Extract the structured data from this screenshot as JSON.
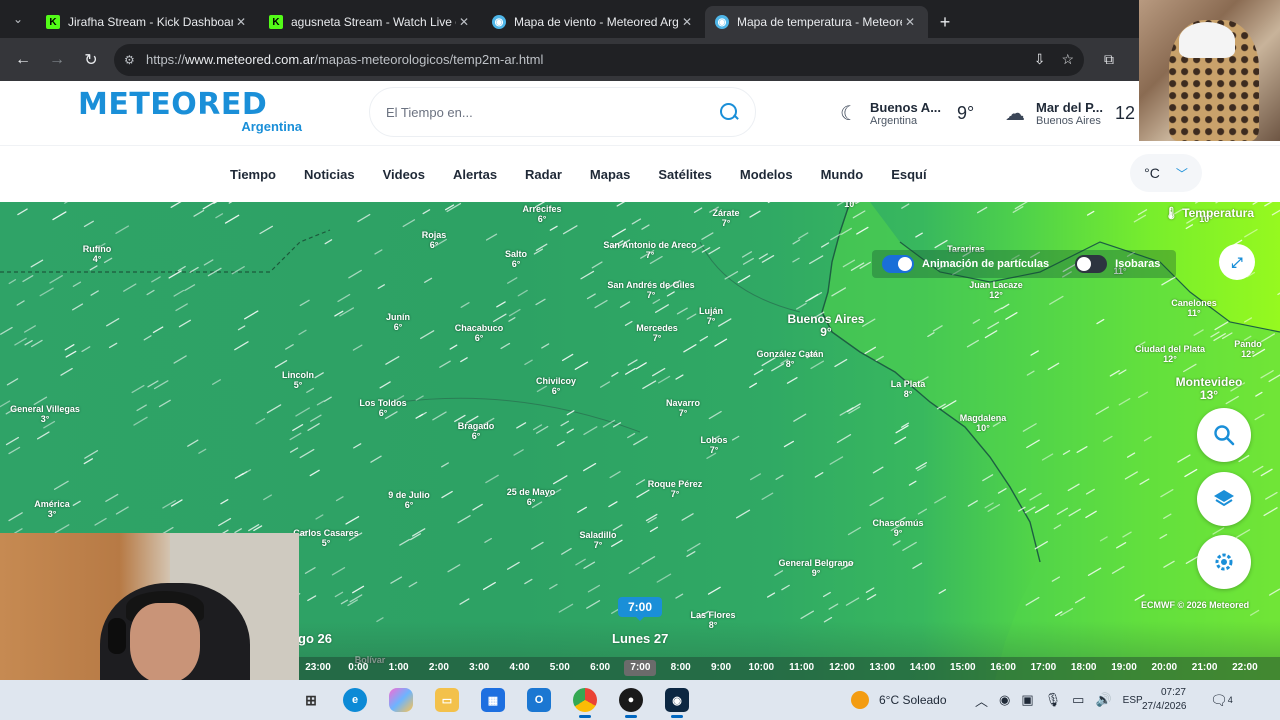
{
  "browser": {
    "tabs": [
      {
        "title": "Jirafha Stream - Kick Dashboard",
        "favicon": "kick-icon",
        "active": false
      },
      {
        "title": "agusneta Stream - Watch Live on Kick",
        "favicon": "kick-icon",
        "active": false
      },
      {
        "title": "Mapa de viento - Meteored Argentina",
        "favicon": "meteored-icon",
        "active": false
      },
      {
        "title": "Mapa de temperatura - Meteored Argentina",
        "favicon": "meteored-icon",
        "active": true
      }
    ],
    "url_host": "www.meteored.com.ar",
    "url_prefix": "https://",
    "url_path": "/mapas-meteorologicos/temp2m-ar.html"
  },
  "site": {
    "logo_text": "METEORED",
    "logo_sub": "Argentina",
    "search_placeholder": "El Tiempo en...",
    "weather_widgets": [
      {
        "city": "Buenos A...",
        "region": "Argentina",
        "temp": "9°",
        "icon": "moon-icon"
      },
      {
        "city": "Mar del P...",
        "region": "Buenos Aires",
        "temp": "12",
        "icon": "cloud-rain-icon"
      }
    ],
    "nav": [
      "Tiempo",
      "Noticias",
      "Videos",
      "Alertas",
      "Radar",
      "Mapas",
      "Satélites",
      "Modelos",
      "Mundo",
      "Esquí"
    ],
    "unit": "°C"
  },
  "map": {
    "layer_title": "Temperatura",
    "toggle_particles": "Animación de partículas",
    "toggle_isobars": "Isobaras",
    "credit": "ECMWF © 2026 Meteored",
    "selected_time": "7:00",
    "day_prev": "go 26",
    "day_current": "Lunes 27",
    "hours": [
      "23:00",
      "0:00",
      "1:00",
      "2:00",
      "3:00",
      "4:00",
      "5:00",
      "6:00",
      "7:00",
      "8:00",
      "9:00",
      "10:00",
      "11:00",
      "12:00",
      "13:00",
      "14:00",
      "15:00",
      "16:00",
      "17:00",
      "18:00",
      "19:00",
      "20:00",
      "21:00",
      "22:00"
    ],
    "cities": [
      {
        "name": "Arrecifes",
        "temp": "6°"
      },
      {
        "name": "Zárate",
        "temp": "7°"
      },
      {
        "name": "10°",
        "temp": ""
      },
      {
        "name": "Rufino",
        "temp": "4°"
      },
      {
        "name": "Rojas",
        "temp": "6°"
      },
      {
        "name": "Salto",
        "temp": "6°"
      },
      {
        "name": "San Antonio de Areco",
        "temp": "7°"
      },
      {
        "name": "San Andrés de Giles",
        "temp": "7°"
      },
      {
        "name": "Luján",
        "temp": "7°"
      },
      {
        "name": "Mercedes",
        "temp": "7°"
      },
      {
        "name": "Junín",
        "temp": "6°"
      },
      {
        "name": "Chacabuco",
        "temp": "6°"
      },
      {
        "name": "Buenos Aires",
        "temp": "9°"
      },
      {
        "name": "González Catán",
        "temp": "8°"
      },
      {
        "name": "Tarariras",
        "temp": ""
      },
      {
        "name": "Juan Lacaze",
        "temp": "12°"
      },
      {
        "name": "Canelones",
        "temp": "11°"
      },
      {
        "name": "Ciudad del Plata",
        "temp": "12°"
      },
      {
        "name": "Pando",
        "temp": "12°"
      },
      {
        "name": "Montevideo",
        "temp": "13°"
      },
      {
        "name": "Lincoln",
        "temp": "5°"
      },
      {
        "name": "Chivilcoy",
        "temp": "6°"
      },
      {
        "name": "La Plata",
        "temp": "8°"
      },
      {
        "name": "General Villegas",
        "temp": "3°"
      },
      {
        "name": "Los Toldos",
        "temp": "6°"
      },
      {
        "name": "Navarro",
        "temp": "7°"
      },
      {
        "name": "Magdalena",
        "temp": "10°"
      },
      {
        "name": "Bragado",
        "temp": "6°"
      },
      {
        "name": "Lobos",
        "temp": "7°"
      },
      {
        "name": "Roque Pérez",
        "temp": "7°"
      },
      {
        "name": "9 de Julio",
        "temp": "6°"
      },
      {
        "name": "25 de Mayo",
        "temp": "6°"
      },
      {
        "name": "América",
        "temp": "3°"
      },
      {
        "name": "Chascomús",
        "temp": "9°"
      },
      {
        "name": "Carlos Casares",
        "temp": "5°"
      },
      {
        "name": "Saladillo",
        "temp": "7°"
      },
      {
        "name": "General Belgrano",
        "temp": "9°"
      },
      {
        "name": "Las Flores",
        "temp": "8°"
      },
      {
        "name": "Bolívar",
        "temp": ""
      },
      {
        "name": "",
        "temp": "10°"
      },
      {
        "name": "",
        "temp": "11°"
      }
    ]
  },
  "taskbar": {
    "weather": "6°C  Soleado",
    "lang": "ESP",
    "time": "07:27",
    "date": "27/4/2026",
    "notifications": "4"
  }
}
